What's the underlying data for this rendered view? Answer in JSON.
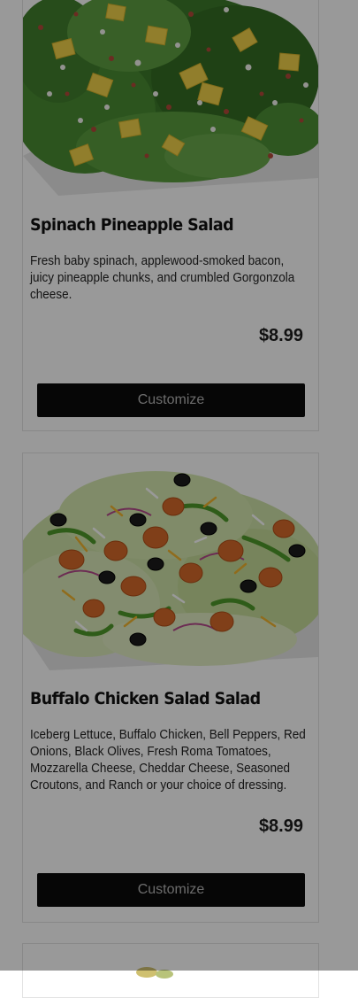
{
  "menu": {
    "items": [
      {
        "name": "Spinach Pineapple Salad",
        "description": "Fresh baby spinach, applewood-smoked bacon, juicy pineapple chunks, and crumbled Gorgonzola cheese.",
        "price": "$8.99",
        "button_label": "Customize",
        "image_icon": "spinach-pineapple-salad-photo"
      },
      {
        "name": "Buffalo Chicken Salad Salad",
        "description": "Iceberg Lettuce, Buffalo Chicken, Bell Peppers, Red Onions, Black Olives, Fresh Roma Tomatoes, Mozzarella Cheese, Cheddar Cheese, Seasoned Croutons, and Ranch or your choice of dressing.",
        "price": "$8.99",
        "button_label": "Customize",
        "image_icon": "buffalo-chicken-salad-photo"
      }
    ]
  },
  "overlay": {
    "color": "#000000",
    "opacity": 0.4
  },
  "colors": {
    "button_bg": "#0b0b0b",
    "button_text": "#b4b4b4",
    "title_text": "#111111",
    "price_text": "#1d1d1d"
  }
}
